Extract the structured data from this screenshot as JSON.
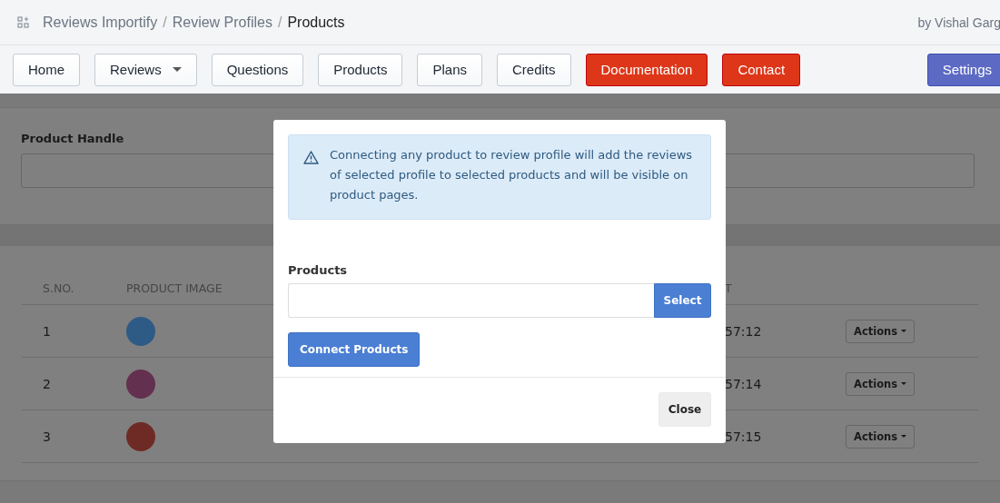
{
  "breadcrumbs": {
    "separator": "/",
    "items": [
      {
        "label": "Reviews Importify",
        "current": false
      },
      {
        "label": "Review Profiles",
        "current": false
      },
      {
        "label": "Products",
        "current": true
      }
    ]
  },
  "author": "by Vishal Garg",
  "nav": [
    {
      "label": "Home",
      "kind": "default"
    },
    {
      "label": "Reviews",
      "kind": "dropdown"
    },
    {
      "label": "Questions",
      "kind": "default"
    },
    {
      "label": "Products",
      "kind": "default"
    },
    {
      "label": "Plans",
      "kind": "default"
    },
    {
      "label": "Credits",
      "kind": "default"
    },
    {
      "label": "Documentation",
      "kind": "danger"
    },
    {
      "label": "Contact",
      "kind": "danger"
    },
    {
      "label": "Settings",
      "kind": "primary"
    }
  ],
  "filter": {
    "label": "Product Handle"
  },
  "table": {
    "columns": [
      "S.NO.",
      "PRODUCT IMAGE",
      "T"
    ],
    "rows": [
      {
        "sno": "1",
        "color": "#2e5a86",
        "time": "57:12",
        "action": "Actions"
      },
      {
        "sno": "2",
        "color": "#63304f",
        "time": "57:14",
        "action": "Actions"
      },
      {
        "sno": "3",
        "color": "#6e2a24",
        "time": "57:15",
        "action": "Actions"
      }
    ]
  },
  "modal": {
    "alert": "Connecting any product to review profile will add the reviews of selected profile to selected products and will be visible on product pages.",
    "field_label": "Products",
    "select_button": "Select",
    "connect_button": "Connect Products",
    "close_button": "Close"
  }
}
